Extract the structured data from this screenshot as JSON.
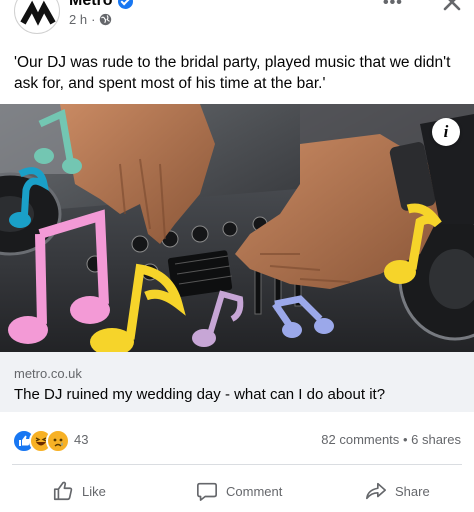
{
  "post": {
    "page_name": "Metro",
    "time": "2 h",
    "separator": "·",
    "more_label": "•••",
    "caption": "'Our DJ was rude to the bridal party, played music that we didn't ask for, and spent most of his time at the bar.'"
  },
  "image": {
    "info_label": "i",
    "icon": "info-icon"
  },
  "link": {
    "domain": "metro.co.uk",
    "title": "The DJ ruined my wedding day - what can I do about it?"
  },
  "reactions": {
    "types": [
      "like",
      "haha",
      "sad"
    ],
    "count": "43",
    "comments": "82 comments",
    "dot": "•",
    "shares": "6 shares"
  },
  "actions": {
    "like": "Like",
    "comment": "Comment",
    "share": "Share"
  },
  "colors": {
    "accent": "#1877f2",
    "meta_text": "#65676b",
    "link_bg": "#f0f2f5"
  }
}
